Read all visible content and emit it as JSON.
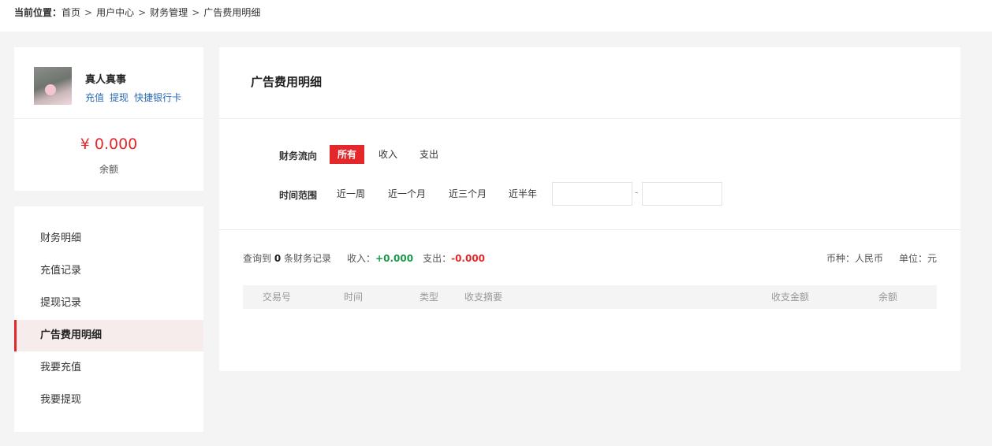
{
  "breadcrumb": {
    "label": "当前位置：",
    "items": [
      "首页",
      "用户中心",
      "财务管理",
      "广告费用明细"
    ],
    "separator": ">"
  },
  "user": {
    "name": "真人真事",
    "links": [
      "充值",
      "提现",
      "快捷银行卡"
    ],
    "balance": "¥ 0.000",
    "balance_label": "余额"
  },
  "menu": {
    "items": [
      "财务明细",
      "充值记录",
      "提现记录",
      "广告费用明细",
      "我要充值",
      "我要提现"
    ],
    "active_index": 3
  },
  "main": {
    "title": "广告费用明细",
    "flow": {
      "label": "财务流向",
      "options": [
        "所有",
        "收入",
        "支出"
      ],
      "selected": "所有"
    },
    "time": {
      "label": "时间范围",
      "options": [
        "近一周",
        "近一个月",
        "近三个月",
        "近半年"
      ],
      "range_separator": "-",
      "start_value": "",
      "end_value": ""
    },
    "summary": {
      "prefix": "查询到",
      "count": "0",
      "count_suffix": "条财务记录",
      "income_label": "收入：",
      "income_value": "+0.000",
      "expense_label": "支出：",
      "expense_value": "-0.000"
    },
    "currency": "币种：人民币",
    "unit": "单位：元",
    "table_headers": [
      "交易号",
      "时间",
      "类型",
      "收支摘要",
      "收支金额",
      "余额"
    ]
  },
  "colors": {
    "accent": "#e4272b",
    "link": "#2a6bb3",
    "income": "#1a9a4a",
    "active_menu_bg": "#f7ecec"
  }
}
